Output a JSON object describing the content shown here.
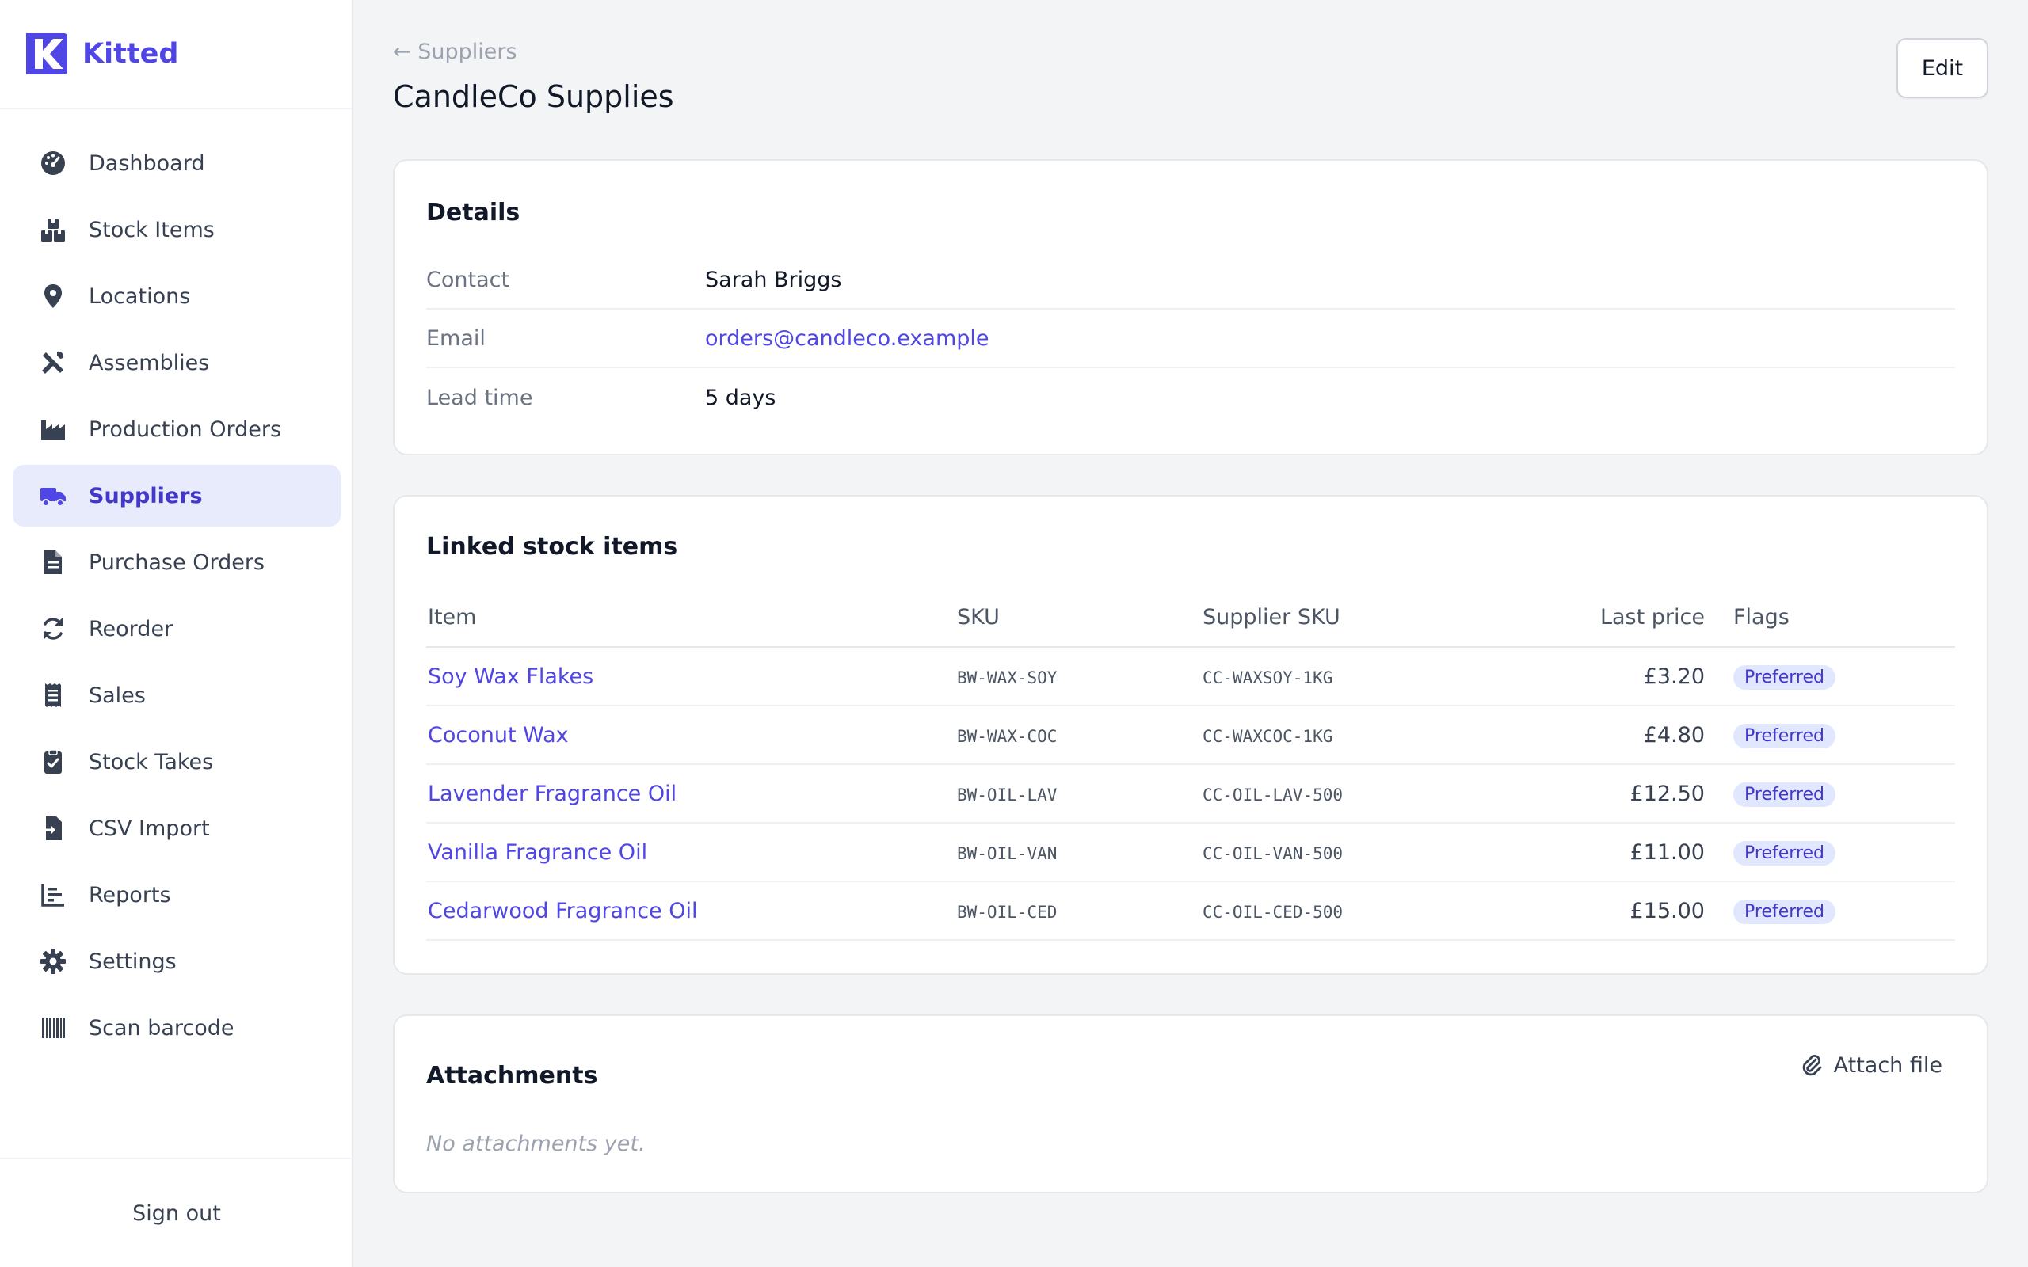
{
  "app": {
    "name": "Kitted",
    "accent_color": "#4f46e5"
  },
  "sidebar": {
    "items": [
      {
        "label": "Dashboard",
        "icon": "gauge-icon"
      },
      {
        "label": "Stock Items",
        "icon": "boxes-icon"
      },
      {
        "label": "Locations",
        "icon": "map-pin-icon"
      },
      {
        "label": "Assemblies",
        "icon": "tools-icon"
      },
      {
        "label": "Production Orders",
        "icon": "factory-icon"
      },
      {
        "label": "Suppliers",
        "icon": "truck-icon",
        "active": true
      },
      {
        "label": "Purchase Orders",
        "icon": "document-icon"
      },
      {
        "label": "Reorder",
        "icon": "refresh-icon"
      },
      {
        "label": "Sales",
        "icon": "receipt-icon"
      },
      {
        "label": "Stock Takes",
        "icon": "clipboard-check-icon"
      },
      {
        "label": "CSV Import",
        "icon": "file-import-icon"
      },
      {
        "label": "Reports",
        "icon": "bar-chart-icon"
      },
      {
        "label": "Settings",
        "icon": "gear-icon"
      },
      {
        "label": "Scan barcode",
        "icon": "barcode-icon"
      }
    ],
    "sign_out_label": "Sign out"
  },
  "header": {
    "back_link": "← Suppliers",
    "title": "CandleCo Supplies",
    "edit_label": "Edit"
  },
  "details": {
    "title": "Details",
    "rows": [
      {
        "label": "Contact",
        "value": "Sarah Briggs"
      },
      {
        "label": "Email",
        "value": "orders@candleco.example"
      },
      {
        "label": "Lead time",
        "value": "5 days"
      }
    ]
  },
  "linked": {
    "title": "Linked stock items",
    "columns": [
      "Item",
      "SKU",
      "Supplier SKU",
      "Last price",
      "Flags"
    ],
    "rows": [
      {
        "item": "Soy Wax Flakes",
        "sku": "BW-WAX-SOY",
        "supplier_sku": "CC-WAXSOY-1KG",
        "price": "£3.20",
        "flag": "Preferred"
      },
      {
        "item": "Coconut Wax",
        "sku": "BW-WAX-COC",
        "supplier_sku": "CC-WAXCOC-1KG",
        "price": "£4.80",
        "flag": "Preferred"
      },
      {
        "item": "Lavender Fragrance Oil",
        "sku": "BW-OIL-LAV",
        "supplier_sku": "CC-OIL-LAV-500",
        "price": "£12.50",
        "flag": "Preferred"
      },
      {
        "item": "Vanilla Fragrance Oil",
        "sku": "BW-OIL-VAN",
        "supplier_sku": "CC-OIL-VAN-500",
        "price": "£11.00",
        "flag": "Preferred"
      },
      {
        "item": "Cedarwood Fragrance Oil",
        "sku": "BW-OIL-CED",
        "supplier_sku": "CC-OIL-CED-500",
        "price": "£15.00",
        "flag": "Preferred"
      }
    ]
  },
  "attachments": {
    "title": "Attachments",
    "attach_label": "Attach file",
    "empty_text": "No attachments yet."
  }
}
